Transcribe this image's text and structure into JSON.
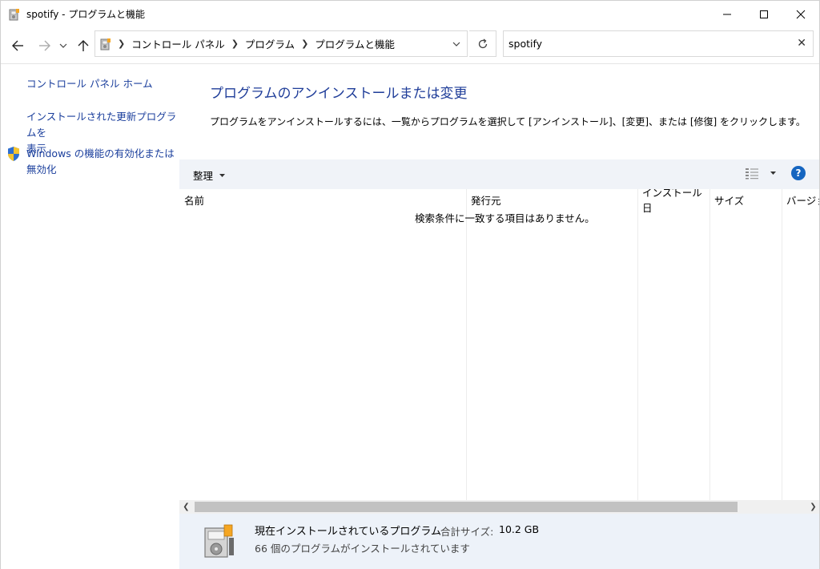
{
  "window": {
    "title": "spotify - プログラムと機能",
    "icon": "programs-icon"
  },
  "nav": {
    "breadcrumbs": [
      "コントロール パネル",
      "プログラム",
      "プログラムと機能"
    ],
    "search_value": "spotify"
  },
  "left_pane": {
    "home_link": "コントロール パネル ホーム",
    "updates_link_line1": "インストールされた更新プログラムを",
    "updates_link_line2": "表示",
    "features_link_line1": "Windows の機能の有効化または",
    "features_link_line2": "無効化"
  },
  "main": {
    "heading": "プログラムのアンインストールまたは変更",
    "description": "プログラムをアンインストールするには、一覧からプログラムを選択して [アンインストール]、[変更]、または [修復] をクリックします。"
  },
  "toolbar": {
    "organize_label": "整理"
  },
  "list": {
    "columns": [
      "名前",
      "発行元",
      "インストール日",
      "サイズ",
      "バージョン"
    ],
    "empty_message": "検索条件に一致する項目はありません。"
  },
  "details": {
    "title": "現在インストールされているプログラム",
    "total_size_label": "合計サイズ:",
    "total_size_value": "10.2 GB",
    "count_text": "66 個のプログラムがインストールされています"
  },
  "colors": {
    "link": "#1f3d99",
    "toolbar_bg": "#f0f3f8",
    "details_bg": "#edf2f9",
    "help_blue": "#1565c0"
  }
}
